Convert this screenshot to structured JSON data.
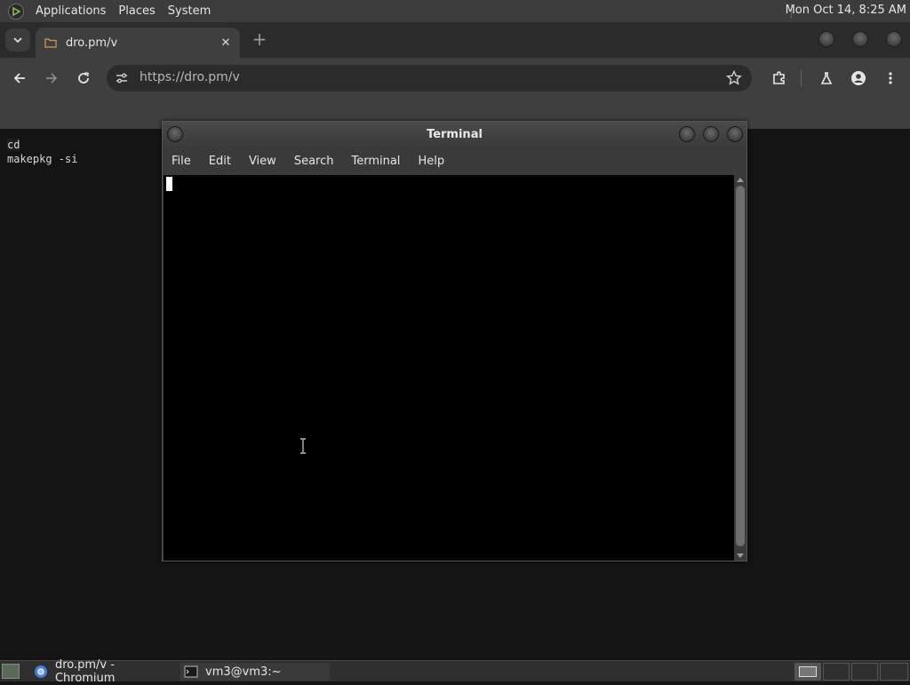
{
  "top_panel": {
    "menus": [
      "Applications",
      "Places",
      "System"
    ],
    "clock": "Mon Oct 14,  8:25 AM"
  },
  "browser": {
    "tab_title": "dro.pm/v",
    "url": "https://dro.pm/v"
  },
  "page": {
    "lines": [
      "cd",
      "makepkg -si"
    ]
  },
  "terminal": {
    "title": "Terminal",
    "menu": [
      "File",
      "Edit",
      "View",
      "Search",
      "Terminal",
      "Help"
    ]
  },
  "taskbar": {
    "items": [
      "dro.pm/v - Chromium",
      "vm3@vm3:~"
    ]
  },
  "colors": {
    "panel": "#3c3c3c",
    "browser_frame": "#2b2b2b",
    "toolbar": "#3f3f3f",
    "terminal_bg": "#000000"
  }
}
